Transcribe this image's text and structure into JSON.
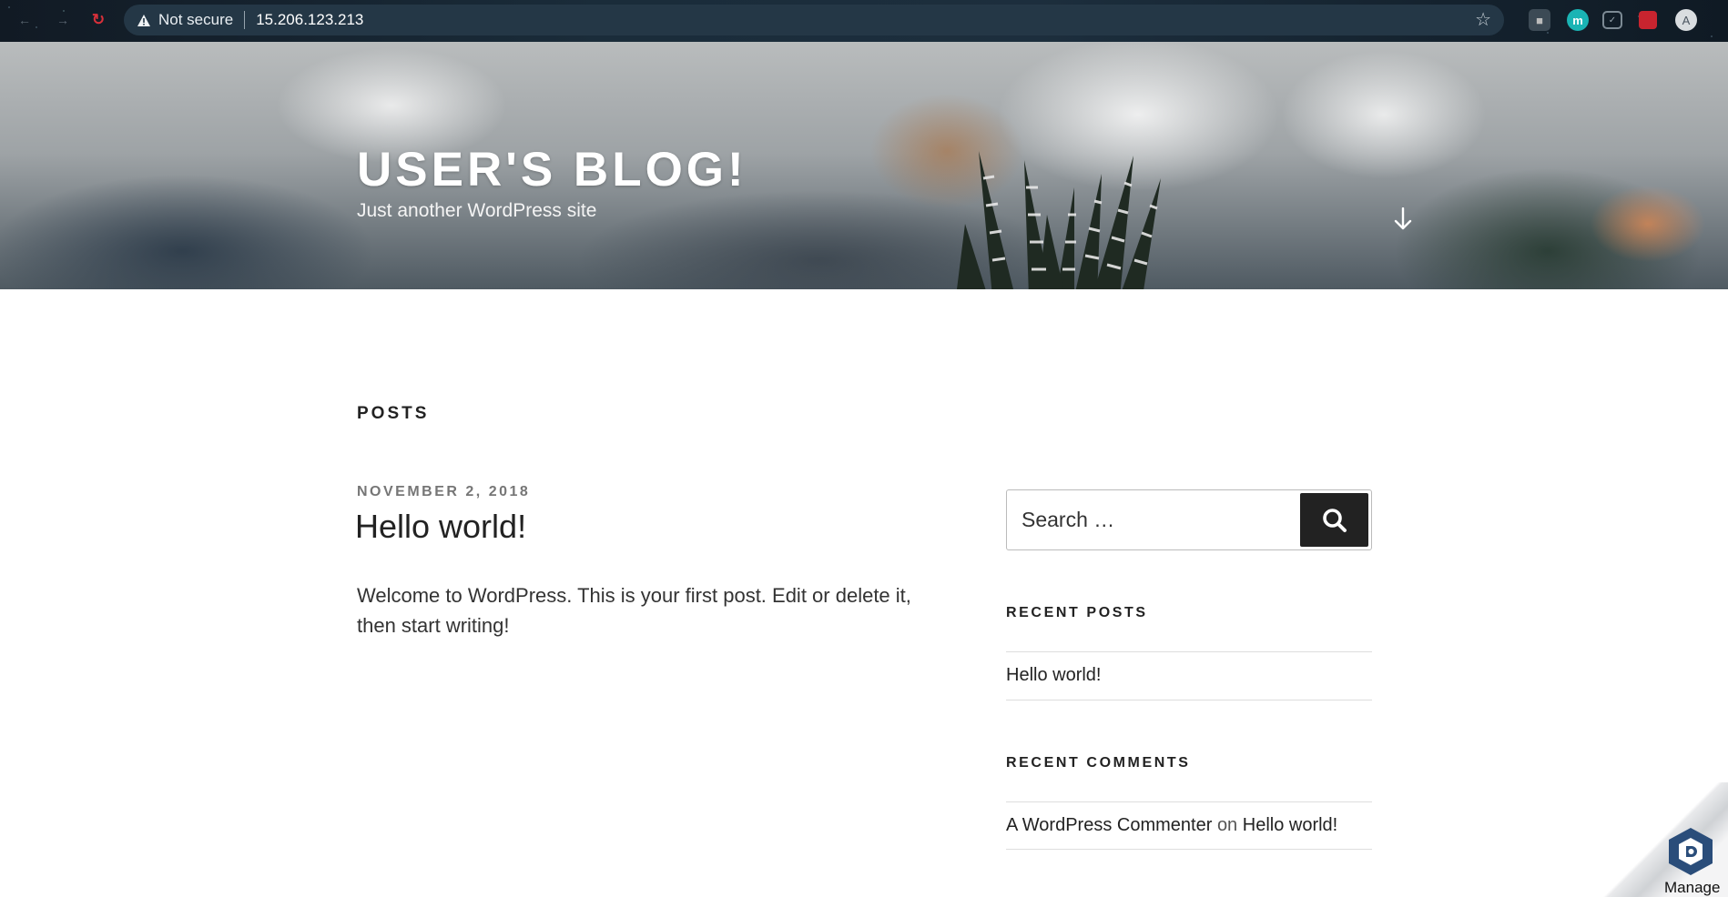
{
  "browser": {
    "security_label": "Not secure",
    "url": "15.206.123.213",
    "extensions": [
      "extension-icon",
      "m",
      "pocket-icon",
      "extension-red-icon"
    ],
    "profile_initial": "A"
  },
  "header": {
    "site_title": "USER'S BLOG!",
    "site_description": "Just another WordPress site"
  },
  "main": {
    "section_title": "POSTS",
    "posts": [
      {
        "date": "NOVEMBER 2, 2018",
        "title": "Hello world!",
        "excerpt": "Welcome to WordPress. This is your first post. Edit or delete it, then start writing!"
      }
    ]
  },
  "sidebar": {
    "search": {
      "placeholder": "Search …"
    },
    "recent_posts": {
      "title": "RECENT POSTS",
      "items": [
        "Hello world!"
      ]
    },
    "recent_comments": {
      "title": "RECENT COMMENTS",
      "items": [
        {
          "author": "A WordPress Commenter",
          "on": "on",
          "post": "Hello world!"
        }
      ]
    }
  },
  "manage_badge": {
    "label": "Manage"
  },
  "colors": {
    "accent_dark": "#222222",
    "warning_red": "#d8303a",
    "teal_ext": "#1ab4b4"
  }
}
